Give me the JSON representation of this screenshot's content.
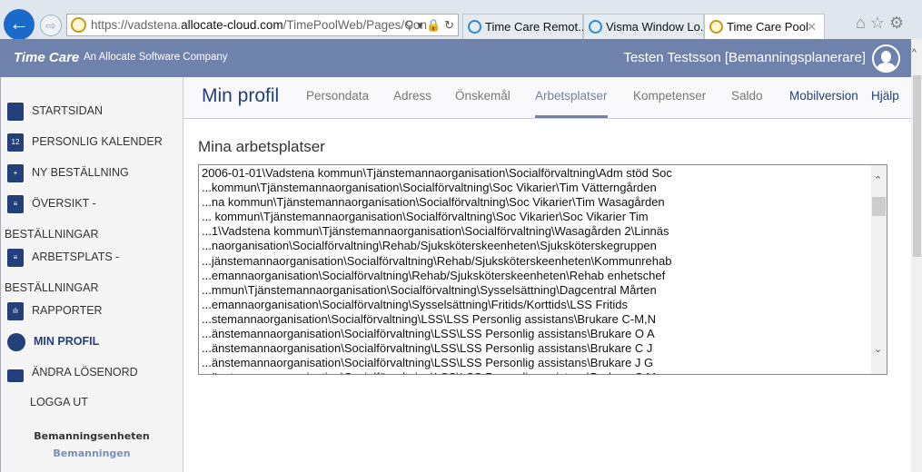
{
  "browser": {
    "url_prefix": "https://vadstena.",
    "url_domain": "allocate-cloud.com",
    "url_path": "/TimePoolWeb/Pages/Con",
    "tabs": [
      {
        "label": "Time Care Remot...",
        "icon": "ie-icon"
      },
      {
        "label": "Visma Window Lo...",
        "icon": "ie-icon"
      },
      {
        "label": "Time Care Pool",
        "icon": "clock-icon",
        "active": true
      }
    ]
  },
  "header": {
    "logo": "Time Care",
    "tagline": "An Allocate Software Company",
    "user": "Testen Testsson [Bemanningsplanerare]"
  },
  "sidebar": {
    "items": [
      {
        "label": "STARTSIDAN",
        "icon": "home-icon"
      },
      {
        "label": "PERSONLIG KALENDER",
        "icon": "calendar-icon"
      },
      {
        "label": "NY BESTÄLLNING",
        "icon": "new-document-icon"
      },
      {
        "label": "ÖVERSIKT -",
        "label2": "BESTÄLLNINGAR",
        "icon": "checklist-icon"
      },
      {
        "label": "ARBETSPLATS -",
        "label2": "BESTÄLLNINGAR",
        "icon": "document-icon"
      },
      {
        "label": "RAPPORTER",
        "icon": "report-icon"
      },
      {
        "label": "MIN PROFIL",
        "icon": "profile-icon",
        "active": true
      },
      {
        "label": "ÄNDRA LÖSENORD",
        "icon": "lock-icon"
      },
      {
        "label": "LOGGA UT"
      }
    ],
    "unit": "Bemanningsenheten",
    "subunit": "Bemanningen"
  },
  "topnav": {
    "title": "Min profil",
    "tabs": [
      "Persondata",
      "Adress",
      "Önskemål",
      "Arbetsplatser",
      "Kompetenser",
      "Saldo"
    ],
    "active_tab": "Arbetsplatser",
    "mobile": "Mobilversion",
    "help": "Hjälp"
  },
  "main": {
    "section_title": "Mina arbetsplatser",
    "workplaces": [
      "2006-01-01\\Vadstena kommun\\Tjänstemannaorganisation\\Socialförvaltning\\Adm stöd Soc",
      "...kommun\\Tjänstemannaorganisation\\Socialförvaltning\\Soc Vikarier\\Tim Vätterngården",
      "...na kommun\\Tjänstemannaorganisation\\Socialförvaltning\\Soc Vikarier\\Tim Wasagården",
      "... kommun\\Tjänstemannaorganisation\\Socialförvaltning\\Soc Vikarier\\Soc Vikarier Tim",
      "...1\\Vadstena kommun\\Tjänstemannaorganisation\\Socialförvaltning\\Wasagården 2\\Linnäs",
      "...naorganisation\\Socialförvaltning\\Rehab/Sjuksköterskeenheten\\Sjuksköterskegruppen",
      "...jänstemannaorganisation\\Socialförvaltning\\Rehab/Sjuksköterskeenheten\\Kommunrehab",
      "...emannaorganisation\\Socialförvaltning\\Rehab/Sjuksköterskeenheten\\Rehab enhetschef",
      "...mmun\\Tjänstemannaorganisation\\Socialförvaltning\\Sysselsättning\\Dagcentral Mårten",
      "...emannaorganisation\\Socialförvaltning\\Sysselsättning\\Fritids/Korttids\\LSS Fritids",
      "...stemannaorganisation\\Socialförvaltning\\LSS\\LSS Personlig assistans\\Brukare C-M,N",
      "...änstemannaorganisation\\Socialförvaltning\\LSS\\LSS Personlig assistans\\Brukare O A",
      "...änstemannaorganisation\\Socialförvaltning\\LSS\\LSS Personlig assistans\\Brukare C J",
      "...änstemannaorganisation\\Socialförvaltning\\LSS\\LSS Personlig assistans\\Brukare J G",
      "...änstemannaorganisation\\Socialförvaltning\\LSS\\LSS Personlig assistans\\Brukare S M"
    ]
  },
  "colors": {
    "header": "#6f82ac",
    "accent": "#23407a"
  }
}
